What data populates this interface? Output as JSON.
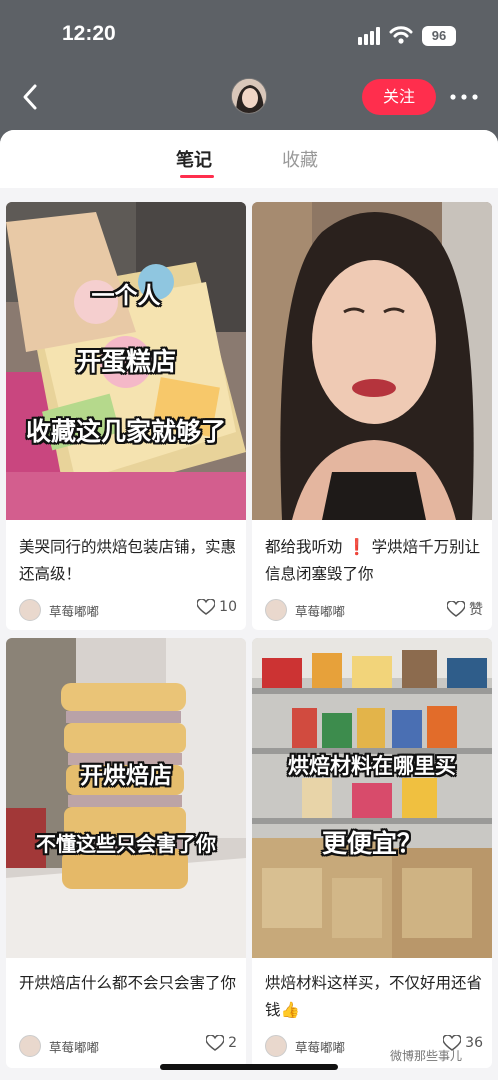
{
  "status_bar": {
    "time": "12:20",
    "battery": "96"
  },
  "nav": {
    "follow_label": "关注"
  },
  "tabs": [
    {
      "label": "笔记"
    },
    {
      "label": "收藏"
    }
  ],
  "cards": [
    {
      "title": "美哭同行的烘焙包装店铺，实惠还高级！",
      "overlay": [
        "一个人",
        "开蛋糕店",
        "收藏这几家就够了"
      ],
      "author": "草莓嘟嘟",
      "likes": "10"
    },
    {
      "title": "都给我听劝 ❗ 学烘焙千万别让信息闭塞毁了你",
      "overlay": [],
      "author": "草莓嘟嘟",
      "likes": "赞"
    },
    {
      "title": "开烘焙店什么都不会只会害了你",
      "overlay": [
        "开烘焙店",
        "不懂这些只会害了你"
      ],
      "author": "草莓嘟嘟",
      "likes": "2"
    },
    {
      "title": "烘焙材料这样买，不仅好用还省钱👍",
      "overlay": [
        "烘焙材料在哪里买",
        "更便宜？"
      ],
      "author": "草莓嘟嘟",
      "likes": "36"
    }
  ],
  "watermark": "微博那些事儿",
  "colors": {
    "accent": "#ff2e4d",
    "background": "#5d6166"
  },
  "icons": [
    "back-chevron-icon",
    "more-dots-icon",
    "heart-icon",
    "signal-icon",
    "wifi-icon"
  ]
}
